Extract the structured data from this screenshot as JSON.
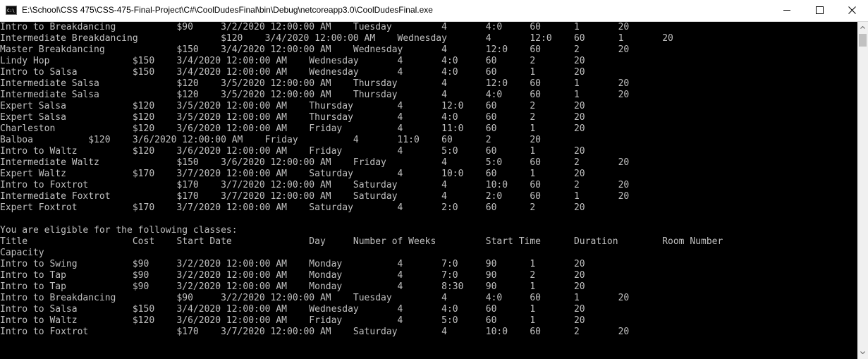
{
  "window": {
    "title": "E:\\School\\CSS 475\\CSS-475-Final-Project\\C#\\CoolDudesFinal\\bin\\Debug\\netcoreapp3.0\\CoolDudesFinal.exe",
    "icon": "console-app-icon",
    "controls": {
      "minimize": "minimize-icon",
      "maximize": "maximize-icon",
      "close": "close-icon"
    }
  },
  "console": {
    "lines": [
      "Intro to Breakdancing           $90     3/2/2020 12:00:00 AM    Tuesday         4       4:0     60      1       20",
      "Intermediate Breakdancing               $120    3/4/2020 12:00:00 AM    Wednesday       4       12:0    60      1       20",
      "Master Breakdancing             $150    3/4/2020 12:00:00 AM    Wednesday       4       12:0    60      2       20",
      "Lindy Hop               $150    3/4/2020 12:00:00 AM    Wednesday       4       4:0     60      2       20",
      "Intro to Salsa          $150    3/4/2020 12:00:00 AM    Wednesday       4       4:0     60      1       20",
      "Intermediate Salsa              $120    3/5/2020 12:00:00 AM    Thursday        4       12:0    60      1       20",
      "Intermediate Salsa              $120    3/5/2020 12:00:00 AM    Thursday        4       4:0     60      1       20",
      "Expert Salsa            $120    3/5/2020 12:00:00 AM    Thursday        4       12:0    60      2       20",
      "Expert Salsa            $120    3/5/2020 12:00:00 AM    Thursday        4       4:0     60      2       20",
      "Charleston              $120    3/6/2020 12:00:00 AM    Friday          4       11:0    60      1       20",
      "Balboa          $120    3/6/2020 12:00:00 AM    Friday          4       11:0    60      2       20",
      "Intro to Waltz          $120    3/6/2020 12:00:00 AM    Friday          4       5:0     60      1       20",
      "Intermediate Waltz              $150    3/6/2020 12:00:00 AM    Friday          4       5:0     60      2       20",
      "Expert Waltz            $170    3/7/2020 12:00:00 AM    Saturday        4       10:0    60      1       20",
      "Intro to Foxtrot                $170    3/7/2020 12:00:00 AM    Saturday        4       10:0    60      2       20",
      "Intermediate Foxtrot            $170    3/7/2020 12:00:00 AM    Saturday        4       2:0     60      1       20",
      "Expert Foxtrot          $170    3/7/2020 12:00:00 AM    Saturday        4       2:0     60      2       20",
      "",
      "You are eligible for the following classes:",
      "Title                   Cost    Start Date              Day     Number of Weeks         Start Time      Duration        Room Number",
      "Capacity",
      "Intro to Swing          $90     3/2/2020 12:00:00 AM    Monday          4       7:0     90      1       20",
      "Intro to Tap            $90     3/2/2020 12:00:00 AM    Monday          4       7:0     90      2       20",
      "Intro to Tap            $90     3/2/2020 12:00:00 AM    Monday          4       8:30    90      1       20",
      "Intro to Breakdancing           $90     3/2/2020 12:00:00 AM    Tuesday         4       4:0     60      1       20",
      "Intro to Salsa          $150    3/4/2020 12:00:00 AM    Wednesday       4       4:0     60      1       20",
      "Intro to Waltz          $120    3/6/2020 12:00:00 AM    Friday          4       5:0     60      1       20",
      "Intro to Foxtrot                $170    3/7/2020 12:00:00 AM    Saturday        4       10:0    60      2       20"
    ]
  },
  "scrollbar": {
    "up_icon": "scroll-up-arrow-icon",
    "down_icon": "scroll-down-arrow-icon"
  }
}
